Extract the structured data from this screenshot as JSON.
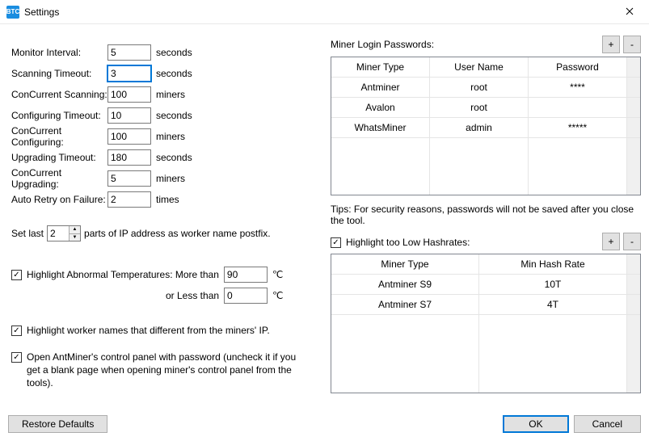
{
  "window": {
    "title": "Settings",
    "icon_text": "BTC"
  },
  "left": {
    "monitor_interval": {
      "label": "Monitor Interval:",
      "value": "5",
      "unit": "seconds"
    },
    "scanning_timeout": {
      "label": "Scanning Timeout:",
      "value": "3",
      "unit": "seconds"
    },
    "concurrent_scanning": {
      "label": "ConCurrent Scanning:",
      "value": "100",
      "unit": "miners"
    },
    "configuring_timeout": {
      "label": "Configuring Timeout:",
      "value": "10",
      "unit": "seconds"
    },
    "concurrent_configuring": {
      "label": "ConCurrent Configuring:",
      "value": "100",
      "unit": "miners"
    },
    "upgrading_timeout": {
      "label": "Upgrading Timeout:",
      "value": "180",
      "unit": "seconds"
    },
    "concurrent_upgrading": {
      "label": "ConCurrent Upgrading:",
      "value": "5",
      "unit": "miners"
    },
    "auto_retry": {
      "label": "Auto Retry on Failure:",
      "value": "2",
      "unit": "times"
    },
    "set_last": {
      "pre": "Set last",
      "value": "2",
      "post": "parts of IP address as worker name postfix."
    },
    "highlight_temp": {
      "checked": true,
      "label": "Highlight Abnormal Temperatures: More than",
      "more_val": "90",
      "deg": "℃",
      "or_less": "or Less than",
      "less_val": "0"
    },
    "highlight_worker": {
      "checked": true,
      "label": "Highlight worker names that different from the miners' IP."
    },
    "open_panel": {
      "checked": true,
      "label": "Open AntMiner's control panel with password (uncheck it if you get a blank page when opening miner's control panel from the tools)."
    }
  },
  "right": {
    "login_label": "Miner Login Passwords:",
    "login_headers": {
      "a": "Miner Type",
      "b": "User Name",
      "c": "Password"
    },
    "logins": [
      {
        "type": "Antminer",
        "user": "root",
        "pass": "****"
      },
      {
        "type": "Avalon",
        "user": "root",
        "pass": ""
      },
      {
        "type": "WhatsMiner",
        "user": "admin",
        "pass": "*****"
      }
    ],
    "tips": "Tips: For security reasons, passwords will not be saved after you close the tool.",
    "highlight_hashrate": {
      "checked": true,
      "label": "Highlight too Low Hashrates:"
    },
    "hash_headers": {
      "a": "Miner Type",
      "b": "Min Hash Rate"
    },
    "hashes": [
      {
        "type": "Antminer S9",
        "min": "10T"
      },
      {
        "type": "Antminer S7",
        "min": "4T"
      }
    ]
  },
  "buttons": {
    "restore": "Restore Defaults",
    "ok": "OK",
    "cancel": "Cancel",
    "plus": "+",
    "minus": "-"
  }
}
